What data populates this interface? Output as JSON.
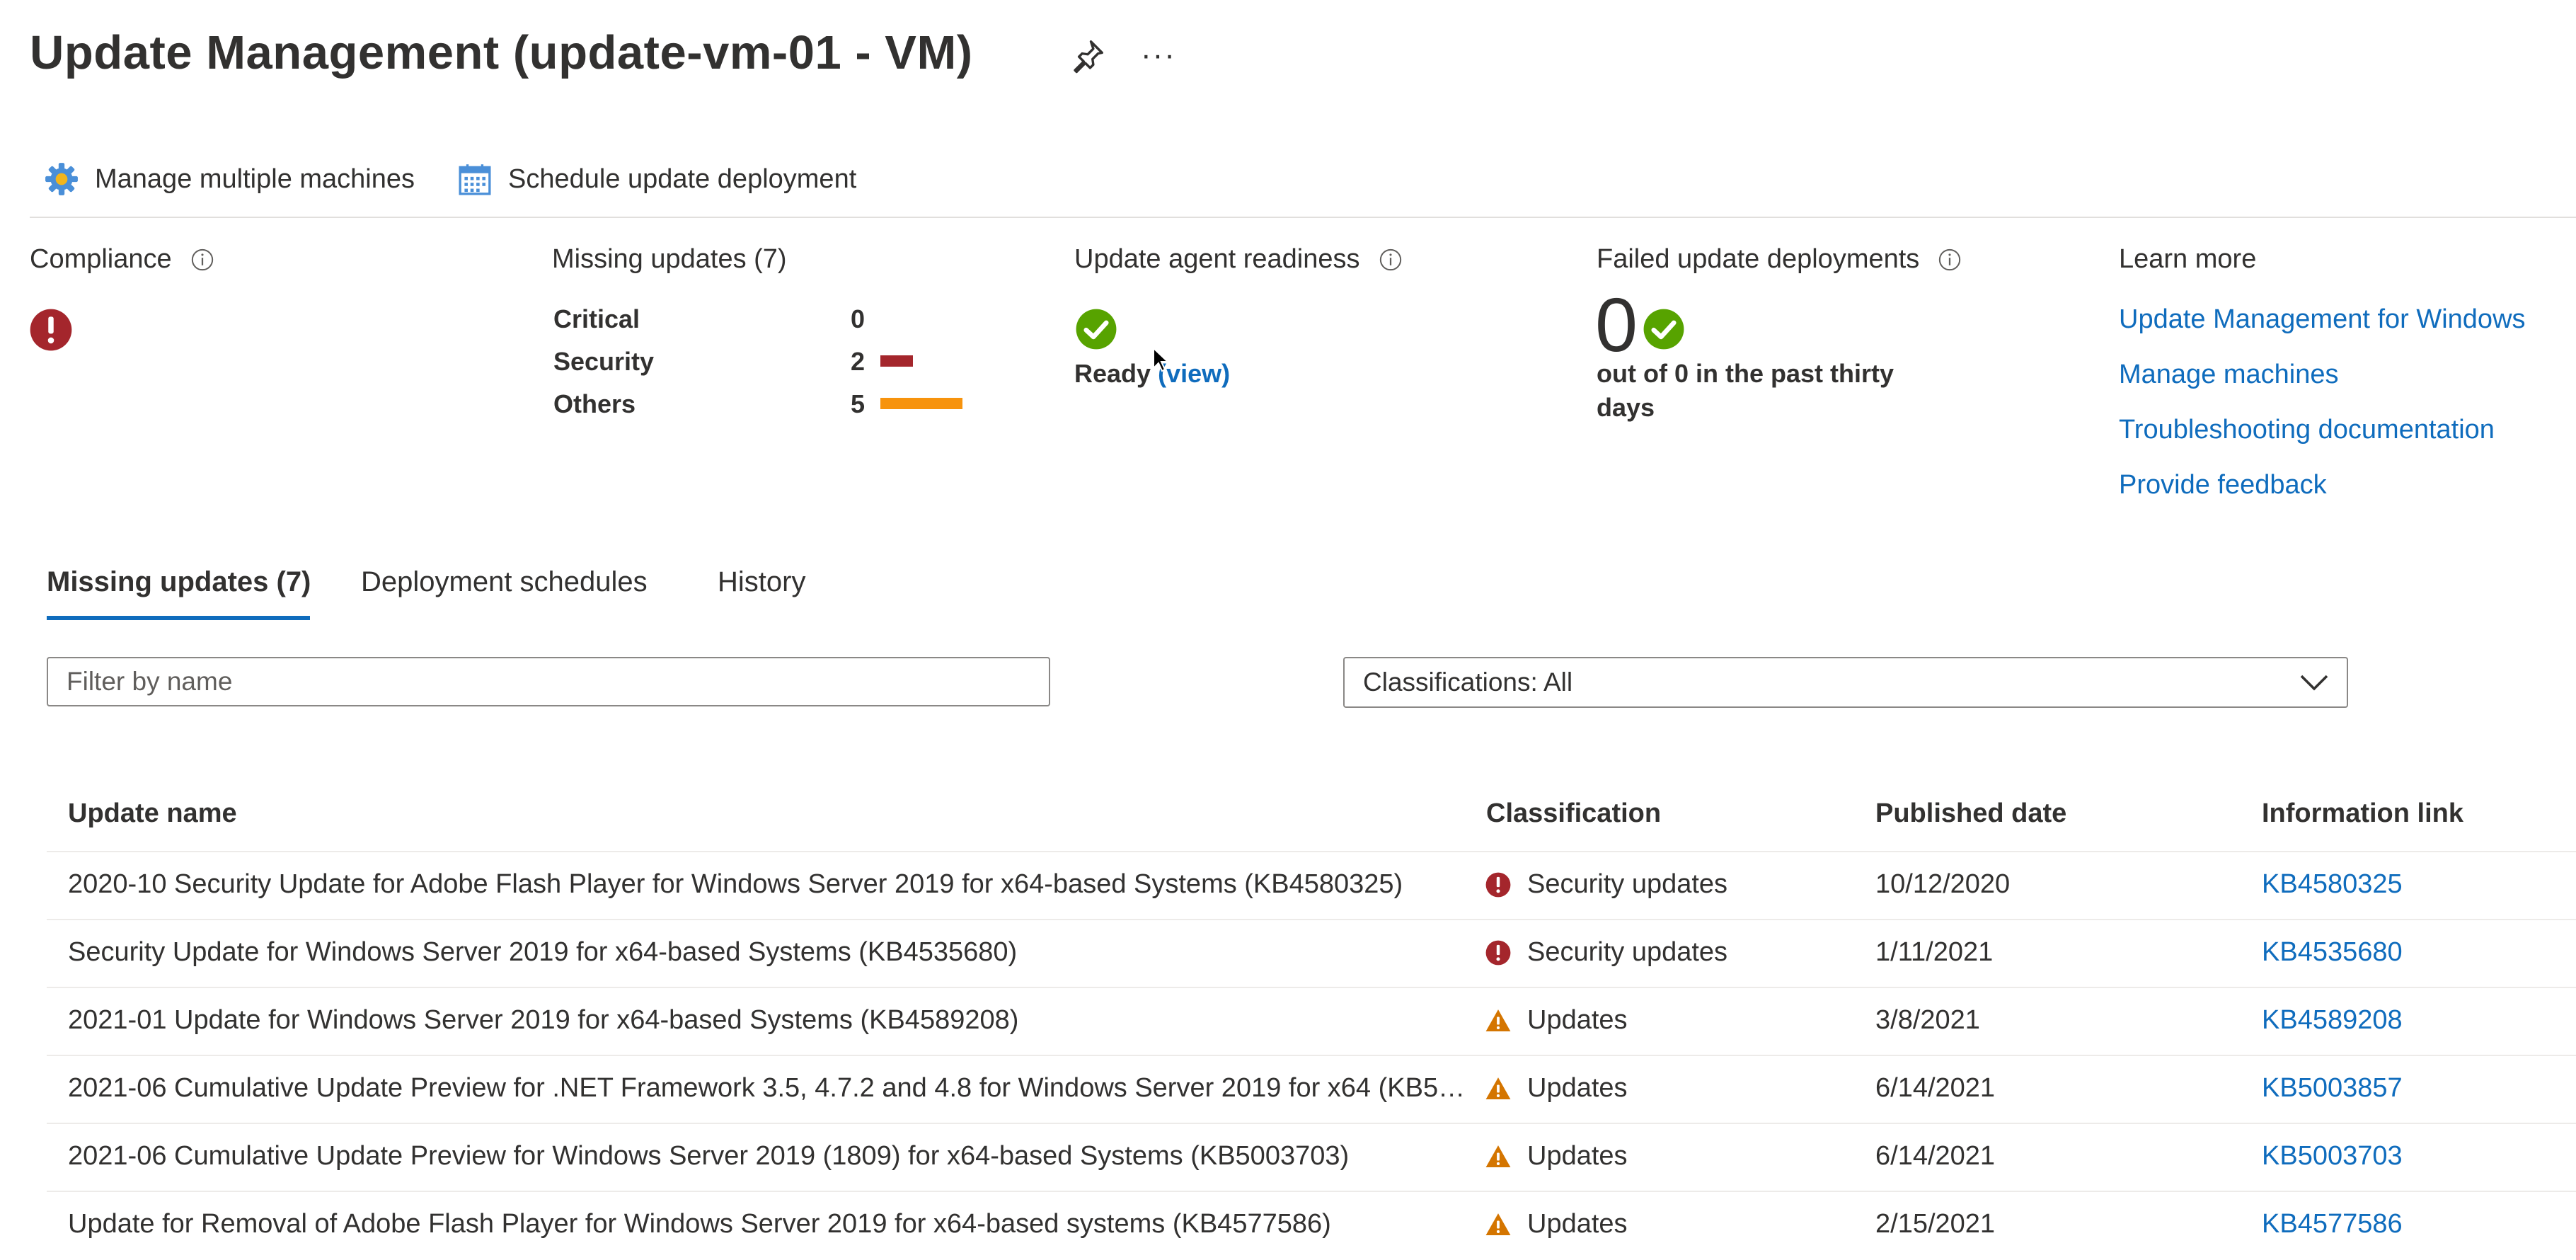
{
  "header": {
    "title": "Update Management (update-vm-01 - VM)",
    "more": "···",
    "pin_icon": "pin-icon"
  },
  "toolbar": {
    "manage_label": "Manage multiple machines",
    "schedule_label": "Schedule update deployment"
  },
  "summary": {
    "compliance": {
      "label": "Compliance"
    },
    "missing": {
      "label": "Missing updates (7)",
      "rows": [
        {
          "name": "Critical",
          "count": "0",
          "color": ""
        },
        {
          "name": "Security",
          "count": "2",
          "color": "#a4262c"
        },
        {
          "name": "Others",
          "count": "5",
          "color": "#f7930d"
        }
      ]
    },
    "agent": {
      "label": "Update agent readiness",
      "status": "Ready",
      "view": "(view)"
    },
    "failed": {
      "label": "Failed update deployments",
      "count": "0",
      "desc": "out of 0 in the past thirty days"
    },
    "learn": {
      "label": "Learn more",
      "links": [
        "Update Management for Windows",
        "Manage machines",
        "Troubleshooting documentation",
        "Provide feedback"
      ]
    }
  },
  "tabs": [
    "Missing updates (7)",
    "Deployment schedules",
    "History"
  ],
  "filter": {
    "placeholder": "Filter by name"
  },
  "classifications": {
    "value": "Classifications: All"
  },
  "table": {
    "headers": [
      "Update name",
      "Classification",
      "Published date",
      "Information link"
    ],
    "rows": [
      {
        "name": "2020-10 Security Update for Adobe Flash Player for Windows Server 2019 for x64-based Systems (KB4580325)",
        "classification": "Security updates",
        "type": "security",
        "date": "10/12/2020",
        "link": "KB4580325"
      },
      {
        "name": "Security Update for Windows Server 2019 for x64-based Systems (KB4535680)",
        "classification": "Security updates",
        "type": "security",
        "date": "1/11/2021",
        "link": "KB4535680"
      },
      {
        "name": "2021-01 Update for Windows Server 2019 for x64-based Systems (KB4589208)",
        "classification": "Updates",
        "type": "update",
        "date": "3/8/2021",
        "link": "KB4589208"
      },
      {
        "name": "2021-06 Cumulative Update Preview for .NET Framework 3.5, 4.7.2 and 4.8 for Windows Server 2019 for x64 (KB5…",
        "classification": "Updates",
        "type": "update",
        "date": "6/14/2021",
        "link": "KB5003857"
      },
      {
        "name": "2021-06 Cumulative Update Preview for Windows Server 2019 (1809) for x64-based Systems (KB5003703)",
        "classification": "Updates",
        "type": "update",
        "date": "6/14/2021",
        "link": "KB5003703"
      },
      {
        "name": "Update for Removal of Adobe Flash Player for Windows Server 2019 for x64-based systems (KB4577586)",
        "classification": "Updates",
        "type": "update",
        "date": "2/15/2021",
        "link": "KB4577586"
      }
    ]
  },
  "colors": {
    "accent": "#0f6cbd",
    "error": "#a4262c",
    "warning": "#d47500",
    "success": "#57a300"
  }
}
